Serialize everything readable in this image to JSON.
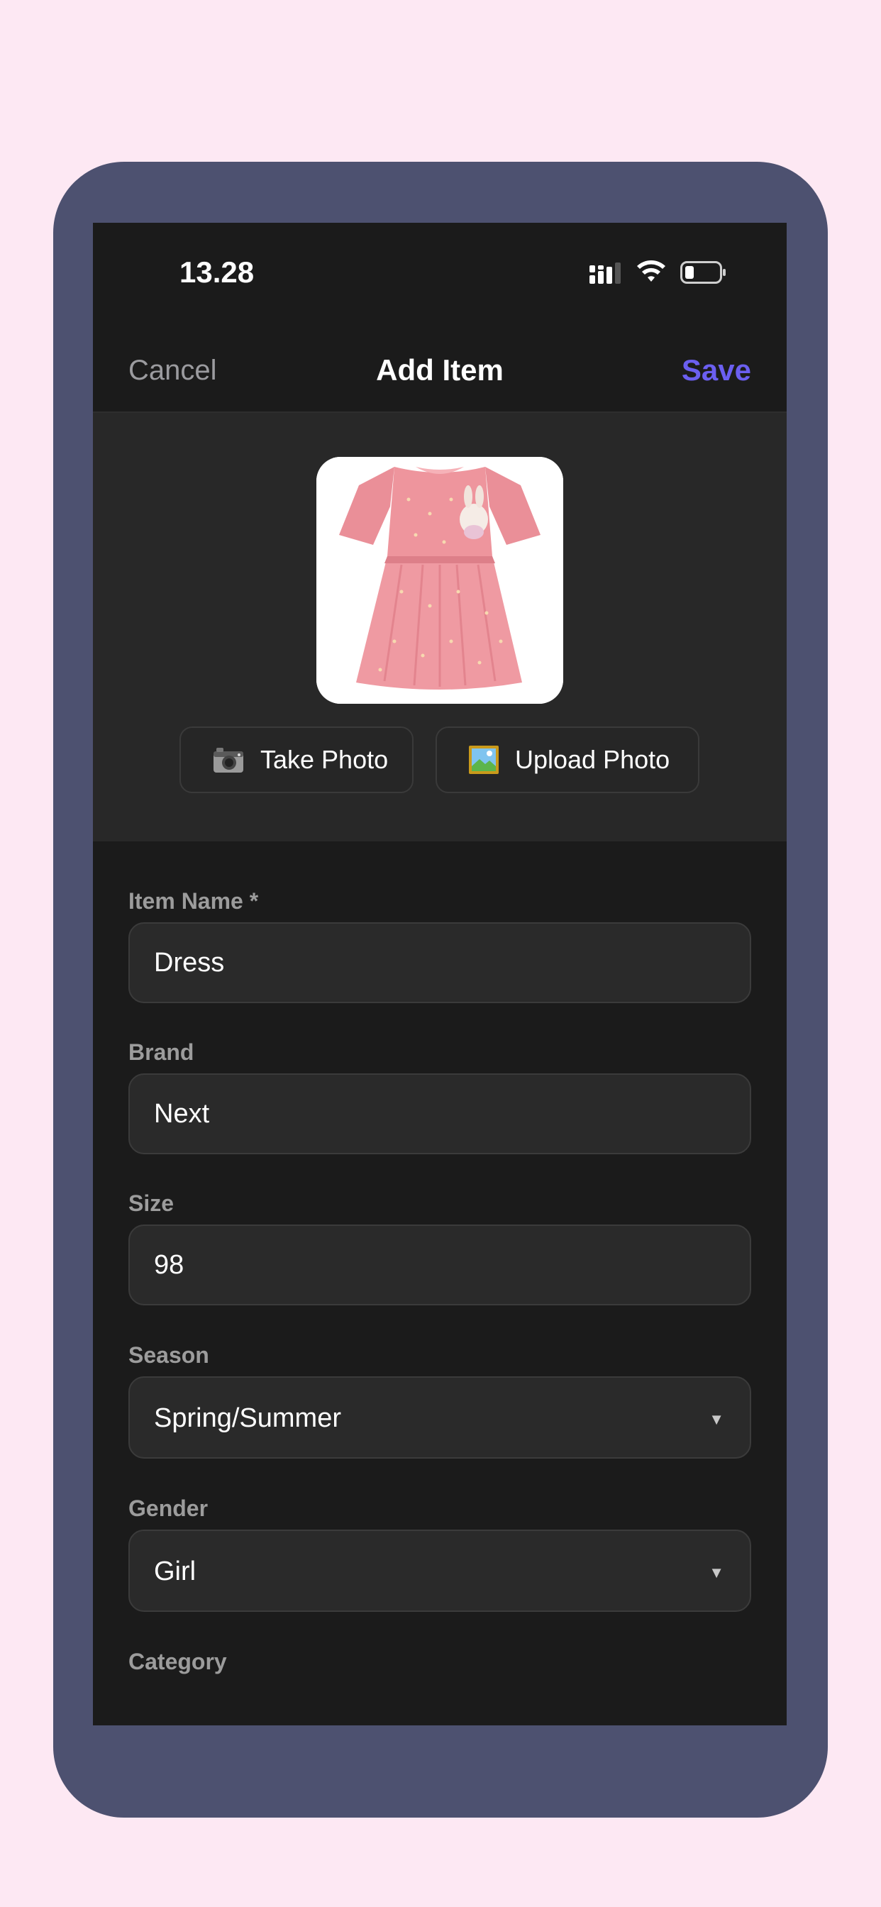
{
  "status_bar": {
    "time": "13.28",
    "icons": [
      "signal-icon",
      "wifi-icon",
      "battery-icon"
    ]
  },
  "nav": {
    "cancel_label": "Cancel",
    "title": "Add Item",
    "save_label": "Save"
  },
  "photo": {
    "image_description_icon": "pink-dress-photo",
    "take_photo": {
      "icon": "camera-icon",
      "label": "Take Photo"
    },
    "upload_photo": {
      "icon": "picture-icon",
      "label": "Upload Photo"
    }
  },
  "form": {
    "item_name": {
      "label": "Item Name *",
      "value": "Dress"
    },
    "brand": {
      "label": "Brand",
      "value": "Next"
    },
    "size": {
      "label": "Size",
      "value": "98"
    },
    "season": {
      "label": "Season",
      "value": "Spring/Summer",
      "caret": "▼"
    },
    "gender": {
      "label": "Gender",
      "value": "Girl",
      "caret": "▼"
    },
    "category": {
      "label": "Category"
    }
  },
  "colors": {
    "page_background": "#fde8f3",
    "device_frame": "#4d5170",
    "screen_background": "#1b1b1b",
    "accent": "#6b5ff0"
  }
}
